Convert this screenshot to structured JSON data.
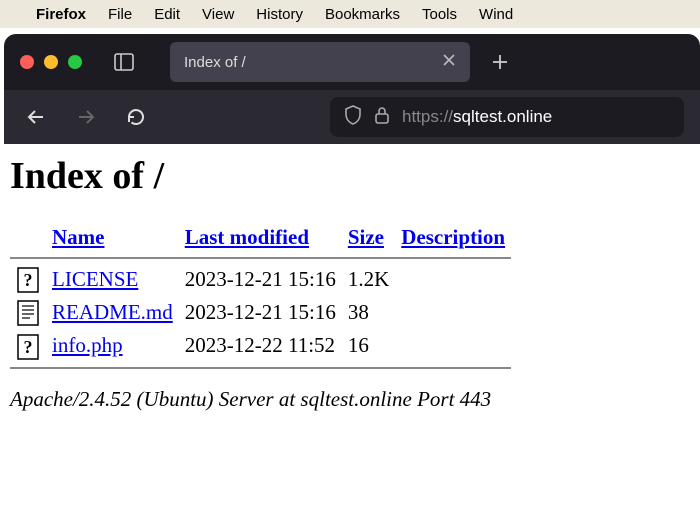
{
  "menubar": {
    "app_name": "Firefox",
    "items": [
      "File",
      "Edit",
      "View",
      "History",
      "Bookmarks",
      "Tools",
      "Wind"
    ]
  },
  "tab": {
    "title": "Index of /"
  },
  "url": {
    "scheme": "https://",
    "domain": "sqltest.online"
  },
  "page": {
    "heading": "Index of /",
    "columns": {
      "name": "Name",
      "modified": "Last modified",
      "size": "Size",
      "description": "Description"
    },
    "files": [
      {
        "icon": "unknown",
        "name": "LICENSE",
        "modified": "2023-12-21 15:16",
        "size": "1.2K",
        "description": ""
      },
      {
        "icon": "text",
        "name": "README.md",
        "modified": "2023-12-21 15:16",
        "size": "38",
        "description": ""
      },
      {
        "icon": "unknown",
        "name": "info.php",
        "modified": "2023-12-22 11:52",
        "size": "16",
        "description": ""
      }
    ],
    "server_signature": "Apache/2.4.52 (Ubuntu) Server at sqltest.online Port 443"
  }
}
